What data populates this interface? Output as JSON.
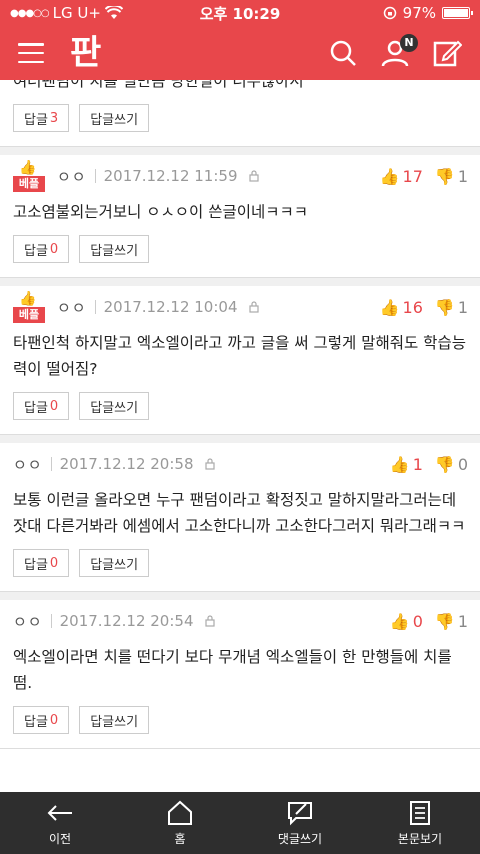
{
  "status": {
    "carrier": "LG U+",
    "time": "오후 10:29",
    "battery": "97%",
    "battery_level": 0.97
  },
  "appbar": {
    "logo": "판",
    "badge": "N"
  },
  "first_fragment": {
    "text": "여러팬덤이 치를 떨만큼 당한일이 너무많아서",
    "reply_label": "답글",
    "reply_count": "3",
    "write_label": "답글쓰기"
  },
  "comments": [
    {
      "best": "베플",
      "author": "ㅇㅇ",
      "date": "2017.12.12 11:59",
      "up": "17",
      "down": "1",
      "text": "고소염불외는거보니 ㅇㅅㅇ이 쓴글이네ㅋㅋㅋ",
      "reply_label": "답글",
      "reply_count": "0",
      "write_label": "답글쓰기"
    },
    {
      "best": "베플",
      "author": "ㅇㅇ",
      "date": "2017.12.12 10:04",
      "up": "16",
      "down": "1",
      "text": "타팬인척 하지말고 엑소엘이라고 까고 글을 써 그렇게 말해줘도 학습능력이 떨어짐?",
      "reply_label": "답글",
      "reply_count": "0",
      "write_label": "답글쓰기"
    },
    {
      "author": "ㅇㅇ",
      "date": "2017.12.12 20:58",
      "up": "1",
      "down": "0",
      "text": "보통 이런글 올라오면 누구 팬덤이라고 확정짓고 말하지말라그러는데 잣대 다른거봐라 에셈에서 고소한다니까 고소한다그러지 뭐라그래ㅋㅋ",
      "reply_label": "답글",
      "reply_count": "0",
      "write_label": "답글쓰기"
    },
    {
      "author": "ㅇㅇ",
      "date": "2017.12.12 20:54",
      "up": "0",
      "down": "1",
      "text": "엑소엘이라면 치를 떤다기 보다 무개념 엑소엘들이 한 만행들에 치를 떰.",
      "reply_label": "답글",
      "reply_count": "0",
      "write_label": "답글쓰기"
    }
  ],
  "bottomnav": {
    "back": "이전",
    "home": "홈",
    "write_comment": "댓글쓰기",
    "view_post": "본문보기"
  }
}
